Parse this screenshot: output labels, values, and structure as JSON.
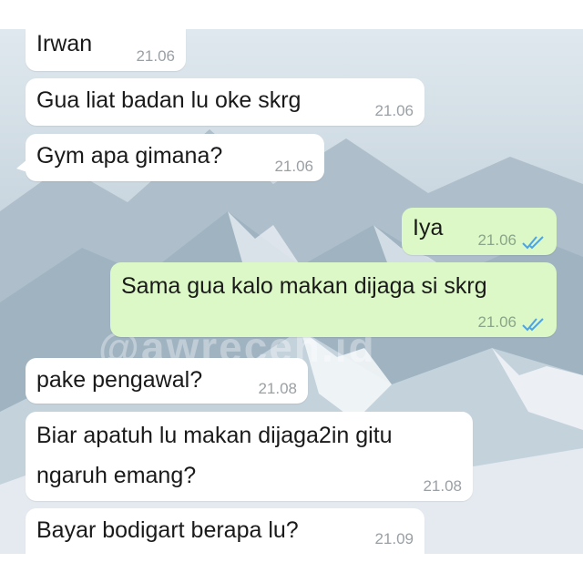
{
  "watermark": "@awreceh.id",
  "messages": [
    {
      "text": "Irwan",
      "time": "21.06"
    },
    {
      "text": "Gua liat badan lu oke skrg",
      "time": "21.06"
    },
    {
      "text": "Gym apa gimana?",
      "time": "21.06"
    },
    {
      "text": "Iya",
      "time": "21.06",
      "outgoing": true
    },
    {
      "text": "Sama gua kalo makan dijaga si skrg",
      "time": "21.06",
      "outgoing": true
    },
    {
      "text": "pake pengawal?",
      "time": "21.08"
    },
    {
      "text": "Biar apatuh lu makan dijaga2in gitu\nngaruh emang?",
      "time": "21.08"
    },
    {
      "text": "Bayar bodigart berapa lu?",
      "time": "21.09"
    }
  ],
  "colors": {
    "incoming_bubble": "#ffffff",
    "outgoing_bubble": "#dcf8c6",
    "read_ticks": "#4fa3e0"
  }
}
